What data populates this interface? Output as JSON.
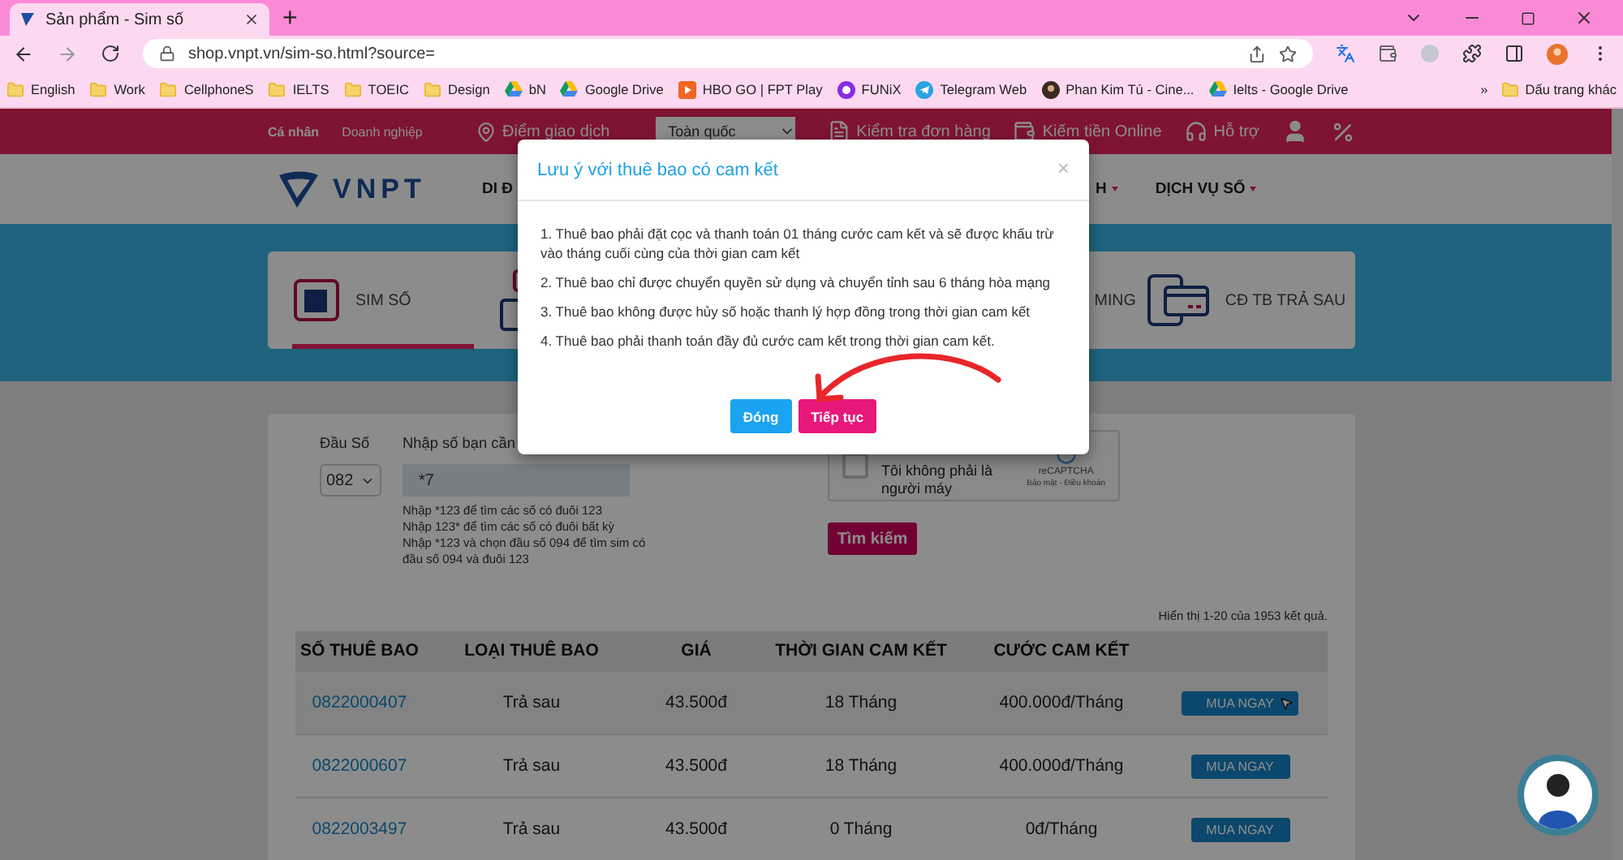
{
  "browser": {
    "tab": {
      "title": "Sản phẩm - Sim số",
      "selected": true
    },
    "new_tab": "+",
    "url": "shop.vnpt.vn/sim-so.html?source=",
    "bookmarks": [
      {
        "label": "English",
        "kind": "folder"
      },
      {
        "label": "Work",
        "kind": "folder"
      },
      {
        "label": "CellphoneS",
        "kind": "folder"
      },
      {
        "label": "IELTS",
        "kind": "folder"
      },
      {
        "label": "TOEIC",
        "kind": "folder"
      },
      {
        "label": "Design",
        "kind": "folder"
      },
      {
        "label": "bN",
        "kind": "drive"
      },
      {
        "label": "Google Drive",
        "kind": "drive"
      },
      {
        "label": "HBO GO | FPT Play",
        "kind": "play"
      },
      {
        "label": "FUNiX",
        "kind": "funix"
      },
      {
        "label": "Telegram Web",
        "kind": "telegram"
      },
      {
        "label": "Phan Kim Tú - Cine...",
        "kind": "person"
      },
      {
        "label": "Ielts - Google Drive",
        "kind": "drive"
      }
    ],
    "more": "»",
    "other_bookmarks": "Dấu trang khác"
  },
  "top_bar": {
    "links": [
      "Cá nhân",
      "Doanh nghiệp"
    ],
    "store_locator": "Điểm giao dịch",
    "region_select": "Toàn quốc",
    "order_check": "Kiểm tra đơn hàng",
    "earn_online": "Kiếm tiền Online",
    "support": "Hỗ trợ"
  },
  "nav": {
    "logo": "VNPT",
    "items": [
      {
        "label": "DI Đ",
        "dropdown": false
      },
      {
        "label": "H",
        "dropdown": true
      },
      {
        "label": "DỊCH VỤ SỐ",
        "dropdown": true
      }
    ]
  },
  "product_tabs": [
    {
      "kind": "sim",
      "label": "SIM SỐ",
      "selected": true
    },
    {
      "kind": "phone",
      "selected": false
    },
    {
      "kind": "text",
      "label": "MING",
      "selected": false
    },
    {
      "kind": "card",
      "label": "CĐ TB TRẢ SAU",
      "selected": false
    }
  ],
  "search_form": {
    "prefix_label": "Đầu Số",
    "prefix_value": "082",
    "number_label": "Nhập số bạn cần",
    "number_value": "*7",
    "hints": [
      "Nhập *123 để tìm các số có đuôi 123",
      "Nhập 123* để tìm các số có đuôi bất kỳ",
      "Nhập *123 và chọn đầu số 094 để tìm sim có đầu số 094 và đuôi 123"
    ],
    "captcha": {
      "label": "Tôi không phải là người máy",
      "checked": false,
      "brand": "reCAPTCHA",
      "terms": "Bảo mật - Điều khoản"
    },
    "search_button": "Tìm kiếm"
  },
  "results_count": "Hiển thị 1-20 của 1953 kết quả.",
  "table": {
    "columns": [
      "SỐ THUÊ BAO",
      "LOẠI THUÊ BAO",
      "GIÁ",
      "THỜI GIAN CAM KẾT",
      "CƯỚC CAM KẾT"
    ],
    "rows": [
      {
        "number": "0822000407",
        "type": "Trả sau",
        "price": "43.500đ",
        "term": "18 Tháng",
        "fee": "400.000đ/Tháng",
        "action": "MUA NGAY",
        "hovered": true
      },
      {
        "number": "0822000607",
        "type": "Trả sau",
        "price": "43.500đ",
        "term": "18 Tháng",
        "fee": "400.000đ/Tháng",
        "action": "MUA NGAY",
        "hovered": false
      },
      {
        "number": "0822003497",
        "type": "Trả sau",
        "price": "43.500đ",
        "term": "0 Tháng",
        "fee": "0đ/Tháng",
        "action": "MUA NGAY",
        "hovered": false
      }
    ]
  },
  "dialog": {
    "open": true,
    "title": "Lưu ý với thuê bao có cam kết",
    "close": "×",
    "items": [
      "1. Thuê bao phải đặt cọc và thanh toán 01 tháng cước cam kết và sẽ được khấu trừ vào tháng cuối cùng của thời gian cam kết",
      "2. Thuê bao chỉ được chuyển quyền sử dụng và chuyển tỉnh sau 6 tháng hòa mạng",
      "3. Thuê bao không được hủy số hoặc thanh lý hợp đồng trong thời gian cam kết",
      "4. Thuê bao phải thanh toán đầy đủ cước cam kết trong thời gian cam kết."
    ],
    "buttons": [
      {
        "label": "Đóng",
        "kind": "secondary"
      },
      {
        "label": "Tiếp tục",
        "kind": "primary"
      }
    ]
  }
}
